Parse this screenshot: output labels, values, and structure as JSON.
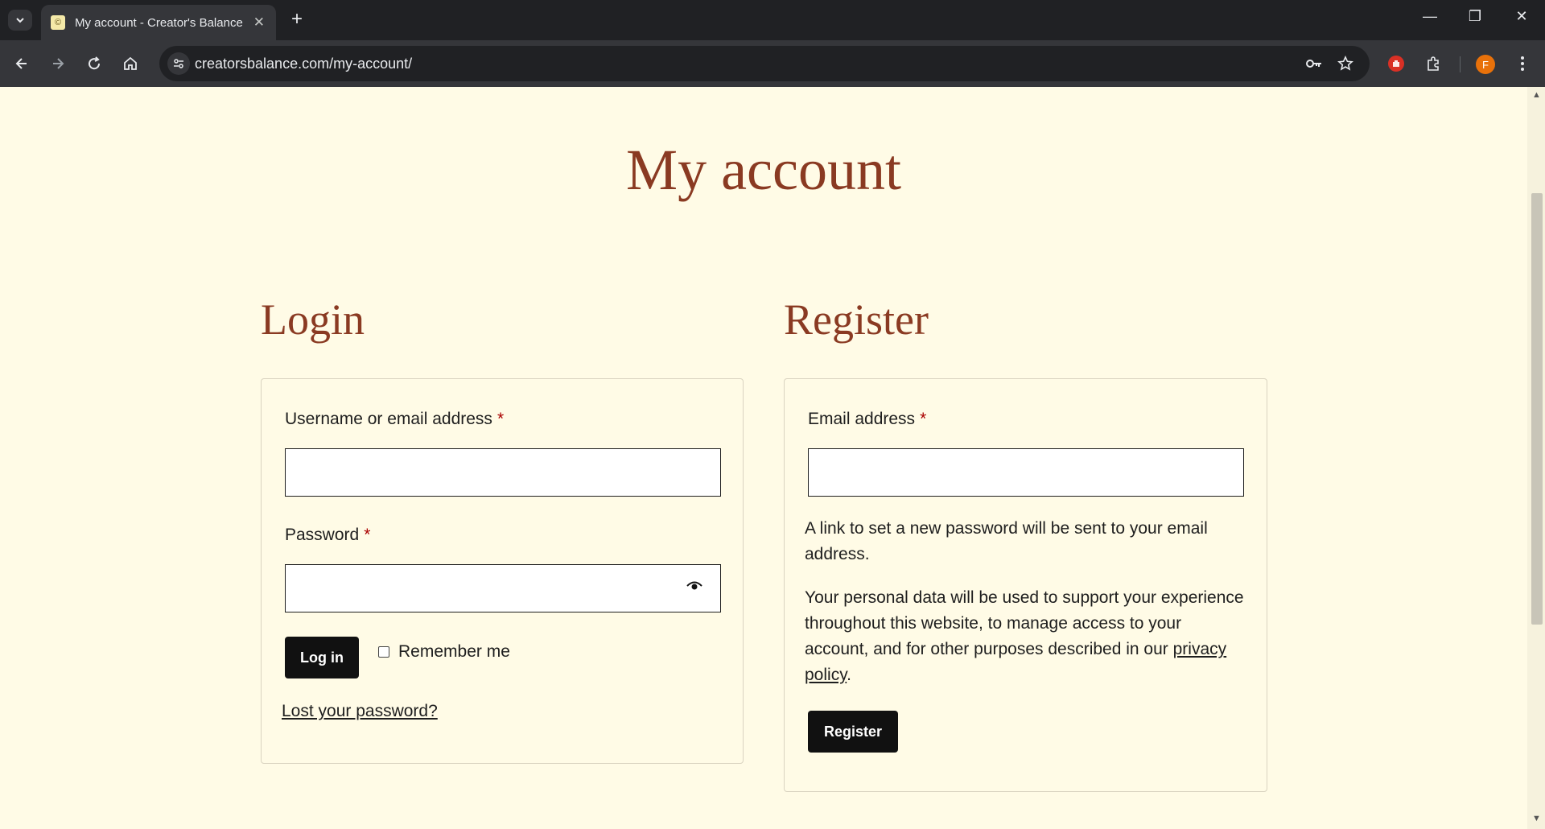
{
  "browser": {
    "tab_title": "My account - Creator's Balance",
    "url": "creatorsbalance.com/my-account/",
    "profile_initial": "F"
  },
  "page": {
    "title": "My account"
  },
  "login": {
    "heading": "Login",
    "username_label": "Username or email address",
    "password_label": "Password",
    "required_mark": "*",
    "username_value": "",
    "password_value": "",
    "login_button": "Log in",
    "remember_me": "Remember me",
    "lost_password": "Lost your password?"
  },
  "register": {
    "heading": "Register",
    "email_label": "Email address",
    "required_mark": "*",
    "email_value": "",
    "info_text": "A link to set a new password will be sent to your email address.",
    "privacy_text_before": "Your personal data will be used to support your experience throughout this website, to manage access to your account, and for other purposes described in our ",
    "privacy_link": "privacy policy",
    "privacy_text_after": ".",
    "register_button": "Register"
  },
  "colors": {
    "background": "#fffbe6",
    "heading": "#8a3a22",
    "button": "#111111",
    "required": "#aa0000"
  }
}
